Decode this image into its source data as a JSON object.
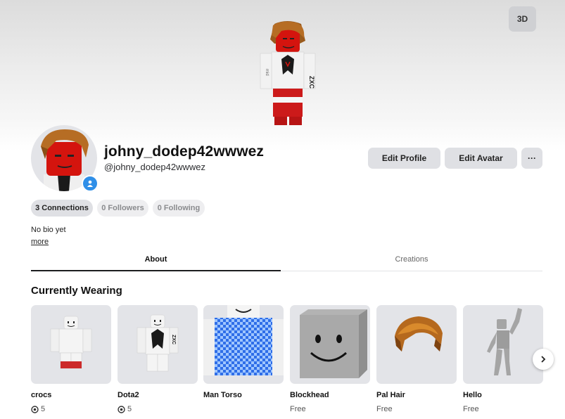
{
  "header": {
    "view_3d_label": "3D"
  },
  "profile": {
    "display_name": "johny_dodep42wwwez",
    "username": "@johny_dodep42wwwez",
    "edit_profile_label": "Edit Profile",
    "edit_avatar_label": "Edit Avatar",
    "more_options_label": "···"
  },
  "stats": {
    "connections": "3 Connections",
    "followers": "0 Followers",
    "following": "0 Following"
  },
  "bio": {
    "text": "No bio yet",
    "more_link": "more"
  },
  "tabs": [
    {
      "label": "About",
      "active": true
    },
    {
      "label": "Creations",
      "active": false
    }
  ],
  "wearing": {
    "title": "Currently Wearing",
    "items": [
      {
        "name": "crocs",
        "price": "5",
        "icon": "robux-icon"
      },
      {
        "name": "Dota2",
        "price": "5",
        "icon": "robux-icon"
      },
      {
        "name": "Man Torso",
        "price": ""
      },
      {
        "name": "Blockhead",
        "price": "Free"
      },
      {
        "name": "Pal Hair",
        "price": "Free"
      },
      {
        "name": "Hello",
        "price": "Free"
      }
    ]
  },
  "colors": {
    "accent_blue": "#2f8fe8",
    "button_gray": "#dfe0e4",
    "card_gray": "#e3e4e8"
  }
}
